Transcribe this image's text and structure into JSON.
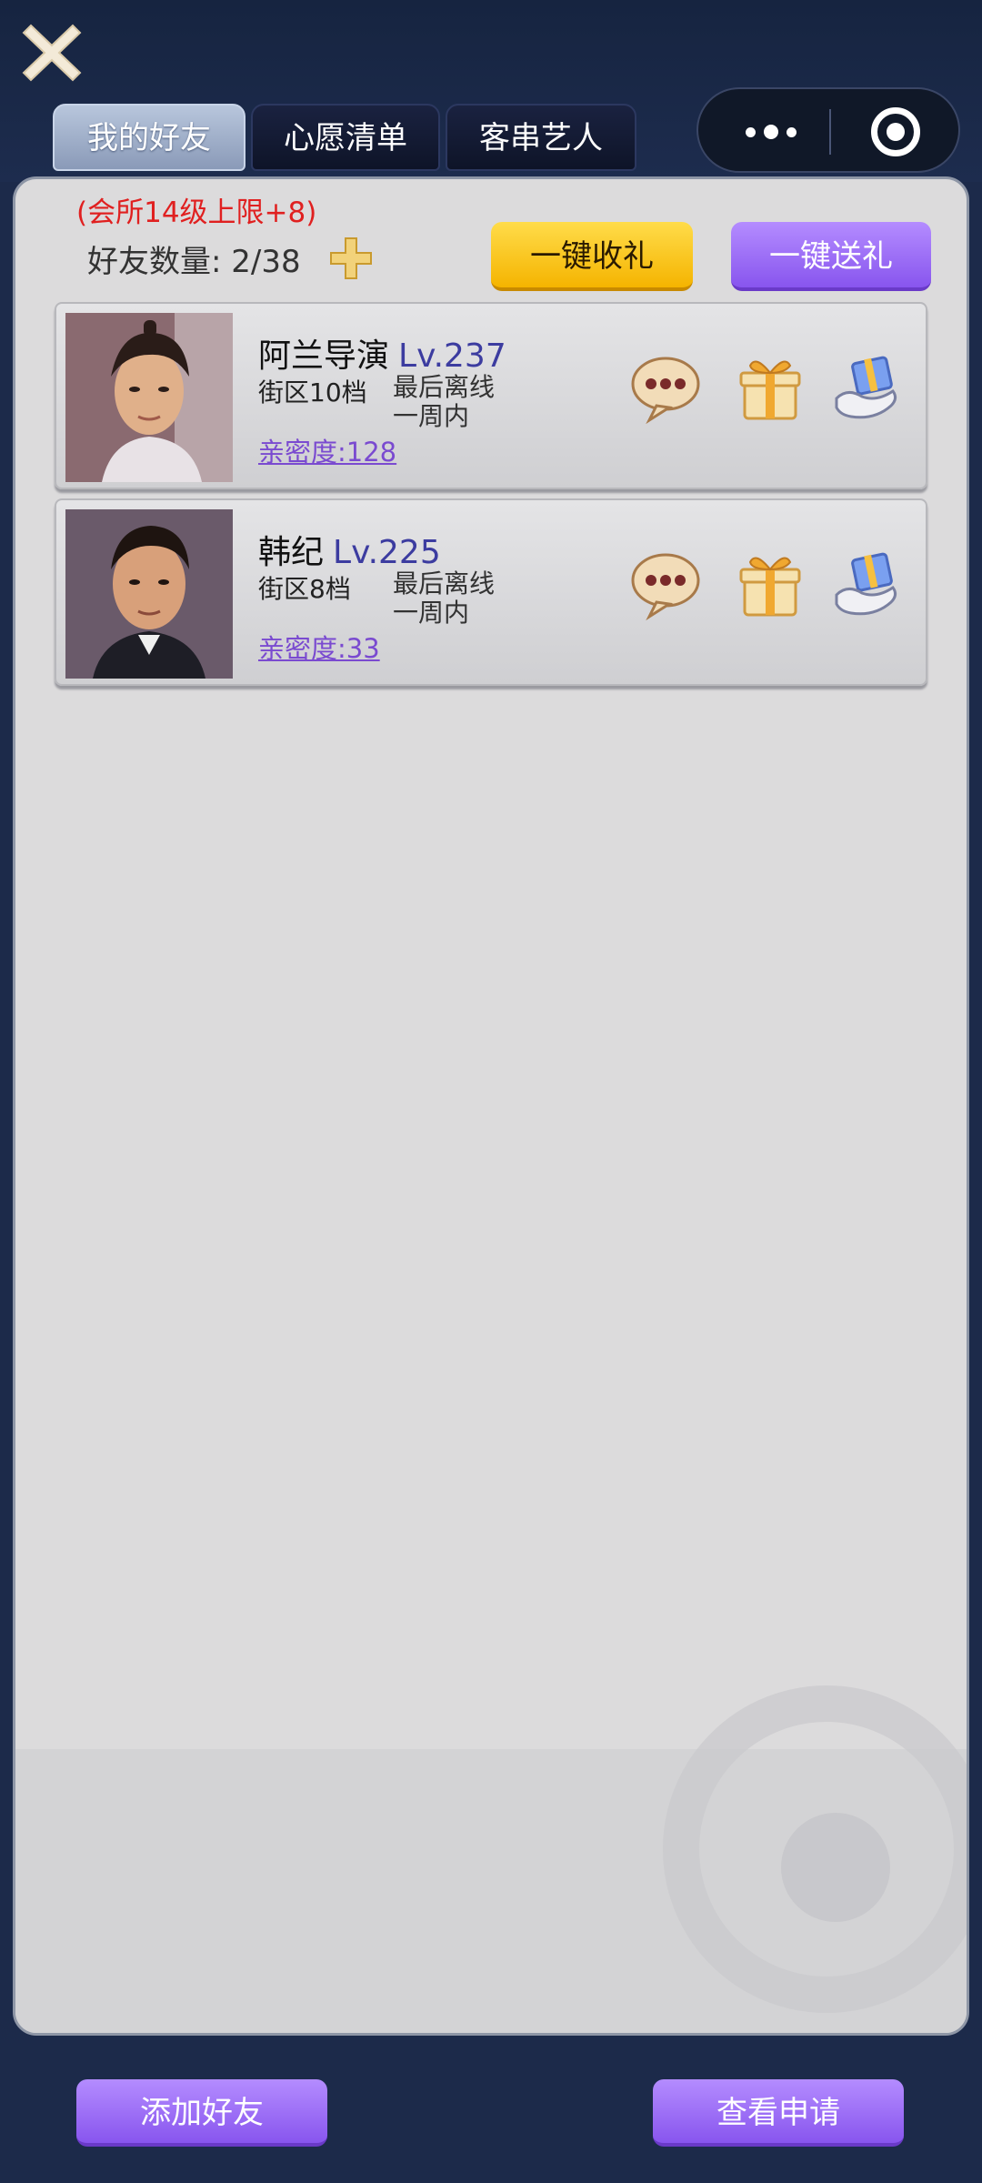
{
  "tabs": [
    {
      "label": "我的好友",
      "active": true
    },
    {
      "label": "心愿清单",
      "active": false
    },
    {
      "label": "客串艺人",
      "active": false
    }
  ],
  "header": {
    "close_icon": "close-icon",
    "menu_icon": "more-dots-icon",
    "target_icon": "target-icon"
  },
  "friends_panel": {
    "limit_note": "(会所14级上限+8)",
    "count_label": "好友数量: 2/38",
    "receive_all_label": "一键收礼",
    "send_all_label": "一键送礼"
  },
  "friends": [
    {
      "name": "阿兰导演",
      "level": "Lv.237",
      "district": "街区10档",
      "offline_line1": "最后离线",
      "offline_line2": "一周内",
      "intimacy": "亲密度:128"
    },
    {
      "name": "韩纪",
      "level": "Lv.225",
      "district": "街区8档",
      "offline_line1": "最后离线",
      "offline_line2": "一周内",
      "intimacy": "亲密度:33"
    }
  ],
  "footer": {
    "add_friend_label": "添加好友",
    "view_requests_label": "查看申请"
  },
  "colors": {
    "background": "#1c2a4a",
    "panel": "#dcdbdc",
    "gold_button": "#f5b400",
    "purple_button": "#8855ee",
    "limit_red": "#e02020",
    "level_blue": "#3c3ca0"
  }
}
